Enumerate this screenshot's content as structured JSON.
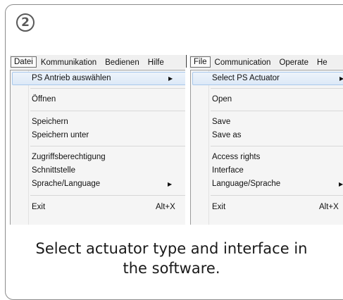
{
  "step_badge": "2",
  "panels": [
    {
      "id": "de",
      "menubar": [
        "Datei",
        "Kommunikation",
        "Bedienen",
        "Hilfe"
      ],
      "items": [
        {
          "label": "PS Antrieb auswählen",
          "submenu": true,
          "highlighted": true
        },
        {
          "label": "Öffnen"
        },
        {
          "label": "Speichern"
        },
        {
          "label": "Speichern unter"
        },
        {
          "label": "Zugriffsberechtigung"
        },
        {
          "label": "Schnittstelle"
        },
        {
          "label": "Sprache/Language",
          "submenu": true
        },
        {
          "label": "Exit",
          "shortcut": "Alt+X"
        }
      ]
    },
    {
      "id": "en",
      "menubar": [
        "File",
        "Communication",
        "Operate",
        "He"
      ],
      "items": [
        {
          "label": "Select PS Actuator",
          "submenu": true,
          "highlighted": true
        },
        {
          "label": "Open"
        },
        {
          "label": "Save"
        },
        {
          "label": "Save as"
        },
        {
          "label": "Access rights"
        },
        {
          "label": "Interface"
        },
        {
          "label": "Language/Sprache",
          "submenu": true
        },
        {
          "label": "Exit",
          "shortcut": "Alt+X"
        }
      ]
    }
  ],
  "caption": {
    "line1": "Select actuator type and interface in",
    "line2": "the software."
  }
}
